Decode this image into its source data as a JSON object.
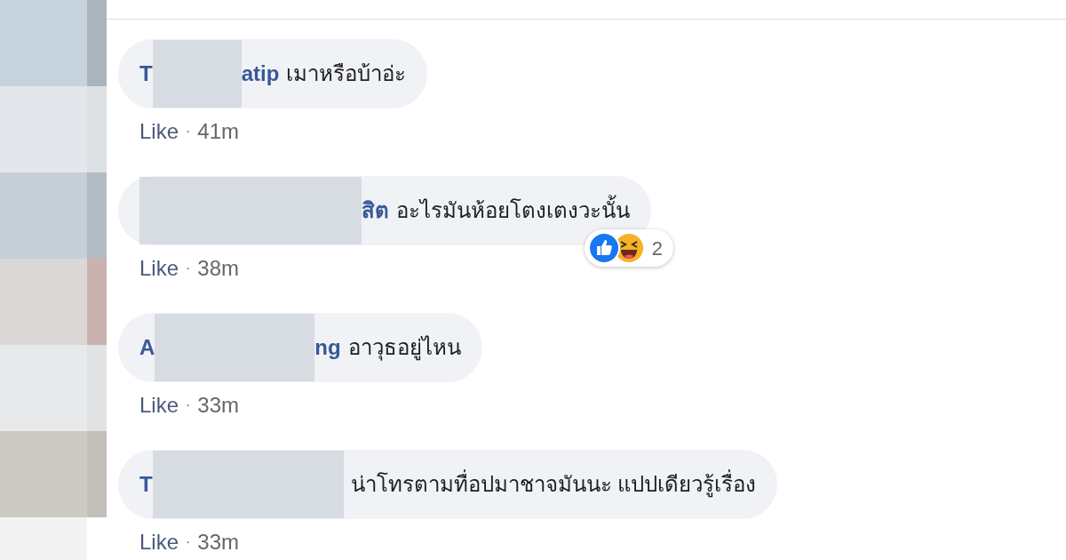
{
  "comments": [
    {
      "name": {
        "start": "T",
        "end": "atip"
      },
      "text": "เมาหรือบ้าอ่ะ",
      "like": "Like",
      "separator": "·",
      "time": "41m"
    },
    {
      "name": {
        "end": "สิต"
      },
      "text": "อะไรมันห้อยโตงเตงวะนั้น",
      "like": "Like",
      "separator": "·",
      "time": "38m",
      "reactions": {
        "icons": [
          {
            "kind": "like"
          },
          {
            "kind": "haha"
          }
        ],
        "count": "2"
      }
    },
    {
      "name": {
        "start": "A",
        "end": "ng"
      },
      "text": "อาวุธอยู่ไหน",
      "like": "Like",
      "separator": "·",
      "time": "33m"
    },
    {
      "name": {
        "start": "T"
      },
      "text": "น่าโทรตามทื่อปมาชาจมันนะ แปปเดียวรู้เรื่อง",
      "like": "Like",
      "separator": "·",
      "time": "33m"
    }
  ]
}
